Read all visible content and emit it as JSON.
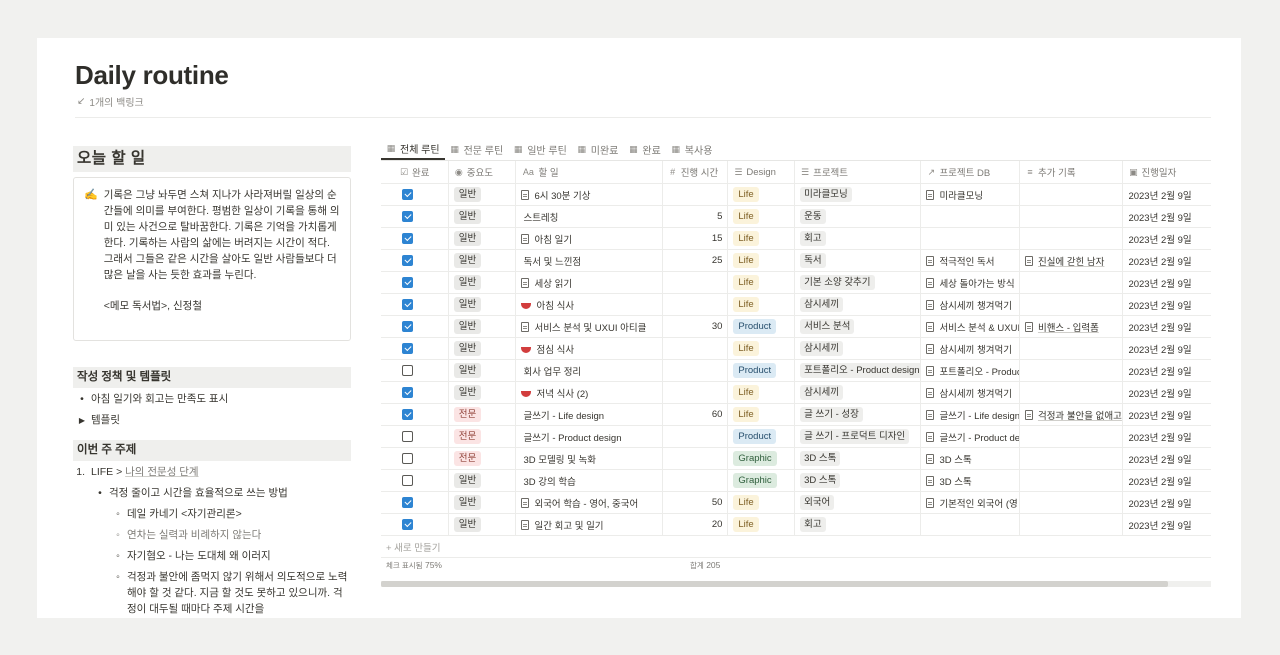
{
  "page": {
    "title": "Daily routine",
    "backlink": "1개의 백링크"
  },
  "left": {
    "today_heading": "오늘 할 일",
    "callout_icon": "✍️",
    "callout_text": "기록은 그냥 놔두면 스쳐 지나가 사라져버릴 일상의 순간들에 의미를 부여한다. 평범한 일상이 기록을 통해 의미 있는 사건으로 탈바꿈한다. 기록은 기억을 가치롭게 한다. 기록하는 사람의 삶에는 버려지는 시간이 적다. 그래서 그들은 같은 시간을 살아도 일반 사람들보다 더 많은 날을 사는 듯한 효과를 누린다.",
    "callout_sig": "<메모 독서법>, 신정철",
    "policy_heading": "작성 정책 및 템플릿",
    "policy_items": [
      "아침 일기와 회고는 만족도 표시",
      "템플릿"
    ],
    "week_heading": "이번 주 주제",
    "week_item_prefix": "LIFE > ",
    "week_item_link": "나의 전문성 단계",
    "week_sub": "걱정 줄이고 시간을 효율적으로 쓰는 방법",
    "week_subsub": [
      "데일 카네기 <자기관리론>",
      "연차는 실력과 비례하지 않는다",
      "자기혐오 - 나는 도대체 왜 이러지",
      "걱정과 불안에 좀먹지 않기 위해서 의도적으로 노력해야 할 것 같다. 지금 할 것도 못하고 있으니까. 걱정이 대두될 때마다 주제 시간을"
    ]
  },
  "tabs": [
    "전체 루틴",
    "전문 루틴",
    "일반 루틴",
    "미완료",
    "완료",
    "복사용"
  ],
  "columns": [
    "완료",
    "중요도",
    "할 일",
    "진행 시간",
    "Design",
    "프로젝트",
    "프로젝트 DB",
    "추가 기록",
    "진행일자"
  ],
  "rows": [
    {
      "done": true,
      "imp": "일반",
      "task": "6시 30분 기상",
      "icon": "doc",
      "time": "",
      "design": "Life",
      "proj": "미라클모닝",
      "db": "미라클모닝",
      "extra": "",
      "date": "2023년 2월 9일"
    },
    {
      "done": true,
      "imp": "일반",
      "task": "스트레칭",
      "icon": "",
      "time": "5",
      "design": "Life",
      "proj": "운동",
      "db": "",
      "extra": "",
      "date": "2023년 2월 9일"
    },
    {
      "done": true,
      "imp": "일반",
      "task": "아침 일기",
      "icon": "doc",
      "time": "15",
      "design": "Life",
      "proj": "회고",
      "db": "",
      "extra": "",
      "date": "2023년 2월 9일"
    },
    {
      "done": true,
      "imp": "일반",
      "task": "독서 및 느낀점",
      "icon": "",
      "time": "25",
      "design": "Life",
      "proj": "독서",
      "db": "적극적인 독서",
      "extra": "진실에 갇힌 남자",
      "date": "2023년 2월 9일"
    },
    {
      "done": true,
      "imp": "일반",
      "task": "세상 읽기",
      "icon": "doc",
      "time": "",
      "design": "Life",
      "proj": "기본 소양 갖추기",
      "db": "세상 돌아가는 방식",
      "extra": "",
      "date": "2023년 2월 9일"
    },
    {
      "done": true,
      "imp": "일반",
      "task": "아침 식사",
      "icon": "bowl",
      "time": "",
      "design": "Life",
      "proj": "삼시세끼",
      "db": "삼시세끼 챙겨먹기",
      "extra": "",
      "date": "2023년 2월 9일"
    },
    {
      "done": true,
      "imp": "일반",
      "task": "서비스 분석 및 UXUI 아티클",
      "icon": "doc",
      "time": "30",
      "design": "Product",
      "proj": "서비스 분석",
      "db": "서비스 분석 & UXUI",
      "extra": "비핸스 - 입력폼",
      "date": "2023년 2월 9일"
    },
    {
      "done": true,
      "imp": "일반",
      "task": "점심 식사",
      "icon": "bowl",
      "time": "",
      "design": "Life",
      "proj": "삼시세끼",
      "db": "삼시세끼 챙겨먹기",
      "extra": "",
      "date": "2023년 2월 9일"
    },
    {
      "done": false,
      "imp": "일반",
      "task": "회사 업무 정리",
      "icon": "",
      "time": "",
      "design": "Product",
      "proj": "포트폴리오 - Product design",
      "db": "포트폴리오 - Product",
      "extra": "",
      "date": "2023년 2월 9일"
    },
    {
      "done": true,
      "imp": "일반",
      "task": "저녁 식사 (2)",
      "icon": "bowl",
      "time": "",
      "design": "Life",
      "proj": "삼시세끼",
      "db": "삼시세끼 챙겨먹기",
      "extra": "",
      "date": "2023년 2월 9일"
    },
    {
      "done": true,
      "imp": "전문",
      "task": "글쓰기 - Life design",
      "icon": "",
      "time": "60",
      "design": "Life",
      "proj": "글 쓰기 - 성장",
      "db": "글쓰기 - Life design",
      "extra": "걱정과 불안을 없애고",
      "date": "2023년 2월 9일"
    },
    {
      "done": false,
      "imp": "전문",
      "task": "글쓰기 - Product design",
      "icon": "",
      "time": "",
      "design": "Product",
      "proj": "글 쓰기 - 프로덕트 디자인",
      "db": "글쓰기 - Product design",
      "extra": "",
      "date": "2023년 2월 9일"
    },
    {
      "done": false,
      "imp": "전문",
      "task": "3D 모델링 및 녹화",
      "icon": "",
      "time": "",
      "design": "Graphic",
      "proj": "3D 스톡",
      "db": "3D 스톡",
      "extra": "",
      "date": "2023년 2월 9일"
    },
    {
      "done": false,
      "imp": "일반",
      "task": "3D 강의 학습",
      "icon": "",
      "time": "",
      "design": "Graphic",
      "proj": "3D 스톡",
      "db": "3D 스톡",
      "extra": "",
      "date": "2023년 2월 9일"
    },
    {
      "done": true,
      "imp": "일반",
      "task": "외국어 학습 - 영어, 중국어",
      "icon": "doc",
      "time": "50",
      "design": "Life",
      "proj": "외국어",
      "db": "기본적인 외국어 (영",
      "extra": "",
      "date": "2023년 2월 9일"
    },
    {
      "done": true,
      "imp": "일반",
      "task": "일간 회고 및 일기",
      "icon": "doc",
      "time": "20",
      "design": "Life",
      "proj": "회고",
      "db": "",
      "extra": "",
      "date": "2023년 2월 9일"
    }
  ],
  "new_row": "+ 새로 만들기",
  "footer": {
    "checked_label": "체크 표시됨",
    "checked_value": "75%",
    "sum_label": "합계",
    "sum_value": "205"
  }
}
